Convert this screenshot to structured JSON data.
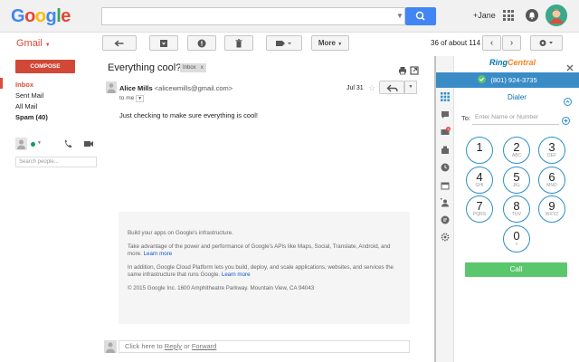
{
  "header": {
    "logo": "Google",
    "search_placeholder": "",
    "user_label": "+Jane"
  },
  "toolbar": {
    "app_label": "Gmail",
    "more_label": "More",
    "page_info": "36 of about 114"
  },
  "sidebar": {
    "compose_label": "COMPOSE",
    "items": [
      {
        "label": "Inbox"
      },
      {
        "label": "Sent Mail"
      },
      {
        "label": "All Mail"
      },
      {
        "label": "Spam (40)"
      }
    ],
    "search_people_placeholder": "Search people..."
  },
  "message": {
    "subject": "Everything cool?",
    "tag": "Inbox",
    "tag_close": "x",
    "sender_name": "Alice Mills",
    "sender_email": "<alicewmills@gmail.com>",
    "recipient": "to me",
    "date": "Jul 31",
    "body": "Just checking to make sure everything is cool!",
    "footer": {
      "p1": "Build your apps on Google's infrastructure.",
      "p2": "Take advantage of the power and performance of Google's APIs like Maps, Social, Translate, Android, and more.",
      "p2_link": "Learn more",
      "p3": "In addition, Google Cloud Platform lets you build, deploy, and scale applications, websites, and services the same infrastructure that runs Google.",
      "p3_link": "Learn more",
      "p4": "© 2015 Google Inc. 1600 Amphitheatre Parkway. Mountain View, CA 94043"
    },
    "reply_prompt": "Click here to",
    "reply_link": "Reply",
    "reply_or": "or",
    "forward_link": "Forward"
  },
  "ringcentral": {
    "logo_ring": "Ring",
    "logo_central": "Central",
    "phone": "(801) 924-3735",
    "dialer_title": "Dialer",
    "to_label": "To:",
    "to_placeholder": "Enter Name or Number",
    "keys": [
      {
        "digit": "1",
        "letters": ""
      },
      {
        "digit": "2",
        "letters": "ABC"
      },
      {
        "digit": "3",
        "letters": "DEF"
      },
      {
        "digit": "4",
        "letters": "GHI"
      },
      {
        "digit": "5",
        "letters": "JKL"
      },
      {
        "digit": "6",
        "letters": "MNO"
      },
      {
        "digit": "7",
        "letters": "PQRS"
      },
      {
        "digit": "8",
        "letters": "TUV"
      },
      {
        "digit": "9",
        "letters": "WXYZ"
      },
      {
        "digit": "0",
        "letters": "+"
      }
    ],
    "call_label": "Call",
    "badge_count": "3"
  },
  "colors": {
    "google_blue": "#4285f4",
    "gmail_red": "#dd4b39",
    "compose_red": "#d14836",
    "rc_blue": "#3a8cc7",
    "call_green": "#5bc76d"
  }
}
